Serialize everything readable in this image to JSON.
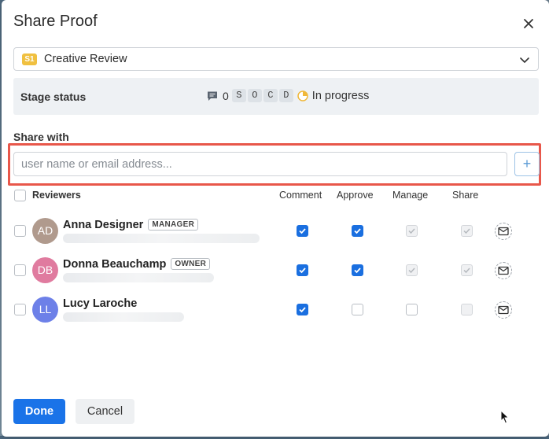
{
  "dialog": {
    "title": "Share Proof",
    "close_icon": "close-icon"
  },
  "stage": {
    "badge": "S1",
    "badge_color": "#f0c040",
    "label": "Creative Review"
  },
  "stage_status": {
    "label": "Stage status",
    "comment_count": "0",
    "letters": [
      "S",
      "O",
      "C",
      "D"
    ],
    "progress_text": "In progress",
    "progress_color": "#f0b83a"
  },
  "share": {
    "label": "Share with",
    "placeholder": "user name or email address...",
    "add_label": "+",
    "highlight_color": "#e8574a"
  },
  "columns": {
    "reviewers": "Reviewers",
    "comment": "Comment",
    "approve": "Approve",
    "manage": "Manage",
    "share": "Share"
  },
  "reviewers": [
    {
      "initials": "AD",
      "name": "Anna Designer",
      "role": "MANAGER",
      "avatar_color": "#b09a8d",
      "comment": true,
      "approve": true,
      "manage": "disabled-checked",
      "share": "disabled-checked"
    },
    {
      "initials": "DB",
      "name": "Donna Beauchamp",
      "role": "OWNER",
      "avatar_color": "#e07b9f",
      "comment": true,
      "approve": true,
      "manage": "disabled-checked",
      "share": "disabled-checked"
    },
    {
      "initials": "LL",
      "name": "Lucy Laroche",
      "role": "",
      "avatar_color": "#6d80e8",
      "comment": true,
      "approve": false,
      "manage": false,
      "share": "disabled"
    }
  ],
  "footer": {
    "done": "Done",
    "cancel": "Cancel",
    "accent": "#1a73e8"
  }
}
